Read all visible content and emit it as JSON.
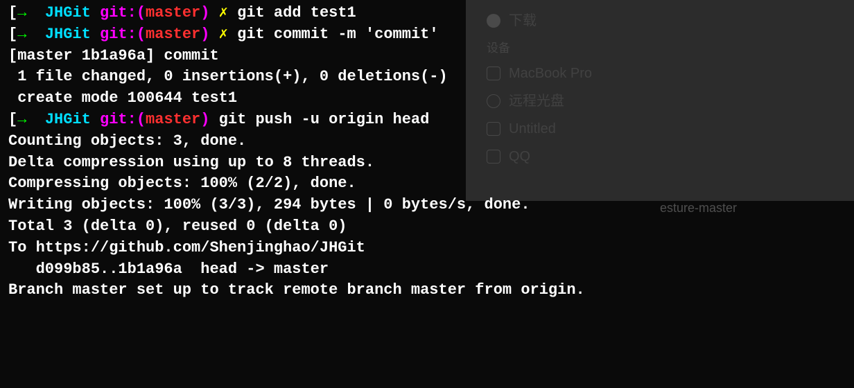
{
  "prompt": {
    "open_bracket": "[",
    "arrow": "→",
    "dir": "JHGit",
    "git_text": "git:(",
    "branch": "master",
    "git_close": ")",
    "dirty_mark": "✗"
  },
  "cmds": {
    "cmd1": "git add test1",
    "cmd2": "git commit -m 'commit'",
    "cmd3": "git push -u origin head"
  },
  "out": {
    "l1": "[master 1b1a96a] commit",
    "l2": " 1 file changed, 0 insertions(+), 0 deletions(-)",
    "l3": " create mode 100644 test1",
    "l4": "Counting objects: 3, done.",
    "l5": "Delta compression using up to 8 threads.",
    "l6": "Compressing objects: 100% (2/2), done.",
    "l7": "Writing objects: 100% (3/3), 294 bytes | 0 bytes/s, done.",
    "l8": "Total 3 (delta 0), reused 0 (delta 0)",
    "l9": "To https://github.com/Shenjinghao/JHGit",
    "l10": "   d099b85..1b1a96a  head -> master",
    "l11": "Branch master set up to track remote branch master from origin."
  },
  "bg": {
    "download": "下载",
    "section_devices": "设备",
    "macbook": "MacBook Pro",
    "remote_disc": "远程光盘",
    "untitled": "Untitled",
    "qq": "QQ",
    "esture": "esture-master"
  }
}
